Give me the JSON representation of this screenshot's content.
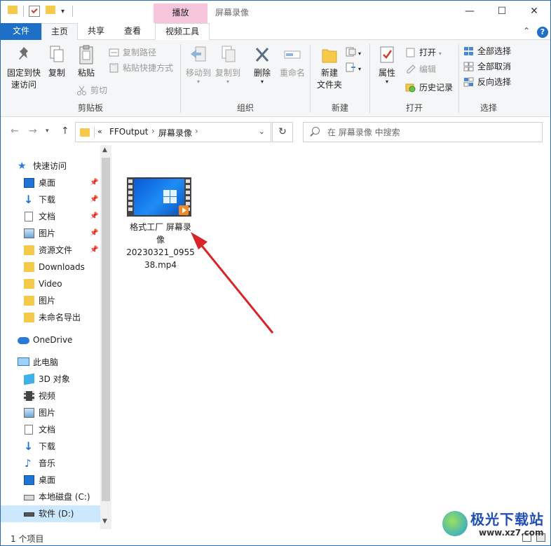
{
  "window": {
    "title": "屏幕录像",
    "context_tab": "播放",
    "controls": {
      "minimize": "—",
      "maximize": "☐",
      "close": "✕"
    }
  },
  "ribbon_tabs": {
    "file": "文件",
    "home": "主页",
    "share": "共享",
    "view": "查看",
    "video_tools": "视频工具"
  },
  "ribbon": {
    "clipboard": {
      "label": "剪贴板",
      "pin_quick_access": "固定到快\n速访问",
      "pin_line1": "固定到快",
      "pin_line2": "速访问",
      "copy": "复制",
      "paste": "粘贴",
      "copy_path": "复制路径",
      "paste_shortcut": "粘贴快捷方式",
      "cut": "剪切"
    },
    "organize": {
      "label": "组织",
      "move_to": "移动到",
      "copy_to": "复制到",
      "delete": "删除",
      "rename": "重命名"
    },
    "new": {
      "label": "新建",
      "new_folder_line1": "新建",
      "new_folder_line2": "文件夹"
    },
    "open": {
      "label": "打开",
      "properties": "属性",
      "open": "打开",
      "edit": "编辑",
      "history": "历史记录"
    },
    "select": {
      "label": "选择",
      "select_all": "全部选择",
      "select_none": "全部取消",
      "invert": "反向选择"
    }
  },
  "address": {
    "overflow": "«",
    "crumbs": [
      "FFOutput",
      "屏幕录像"
    ],
    "search_placeholder": "在 屏幕录像 中搜索"
  },
  "nav_pane": {
    "quick_access": "快速访问",
    "quick_items": [
      {
        "label": "桌面",
        "pinned": true
      },
      {
        "label": "下载",
        "pinned": true
      },
      {
        "label": "文档",
        "pinned": true
      },
      {
        "label": "图片",
        "pinned": true
      },
      {
        "label": "资源文件",
        "pinned": true
      },
      {
        "label": "Downloads",
        "pinned": false
      },
      {
        "label": "Video",
        "pinned": false
      },
      {
        "label": "图片",
        "pinned": false
      },
      {
        "label": "未命名导出",
        "pinned": false
      }
    ],
    "onedrive": "OneDrive",
    "this_pc": "此电脑",
    "pc_items": [
      "3D 对象",
      "视频",
      "图片",
      "文档",
      "下载",
      "音乐",
      "桌面",
      "本地磁盘 (C:)",
      "软件 (D:)"
    ]
  },
  "content": {
    "file": {
      "name_line1": "格式工厂 屏幕录",
      "name_line2": "像",
      "name_line3": "20230321_0955",
      "name_line4": "38.mp4"
    }
  },
  "status": {
    "item_count": "1 个项目"
  },
  "watermark": {
    "brand": "极光下载站",
    "url": "www.xz7.com"
  },
  "colors": {
    "file_tab": "#1e6fc7",
    "context_tab": "#f7c6dc",
    "selection": "#cce8ff",
    "arrow": "#d9252a",
    "folder": "#f6c94a"
  }
}
